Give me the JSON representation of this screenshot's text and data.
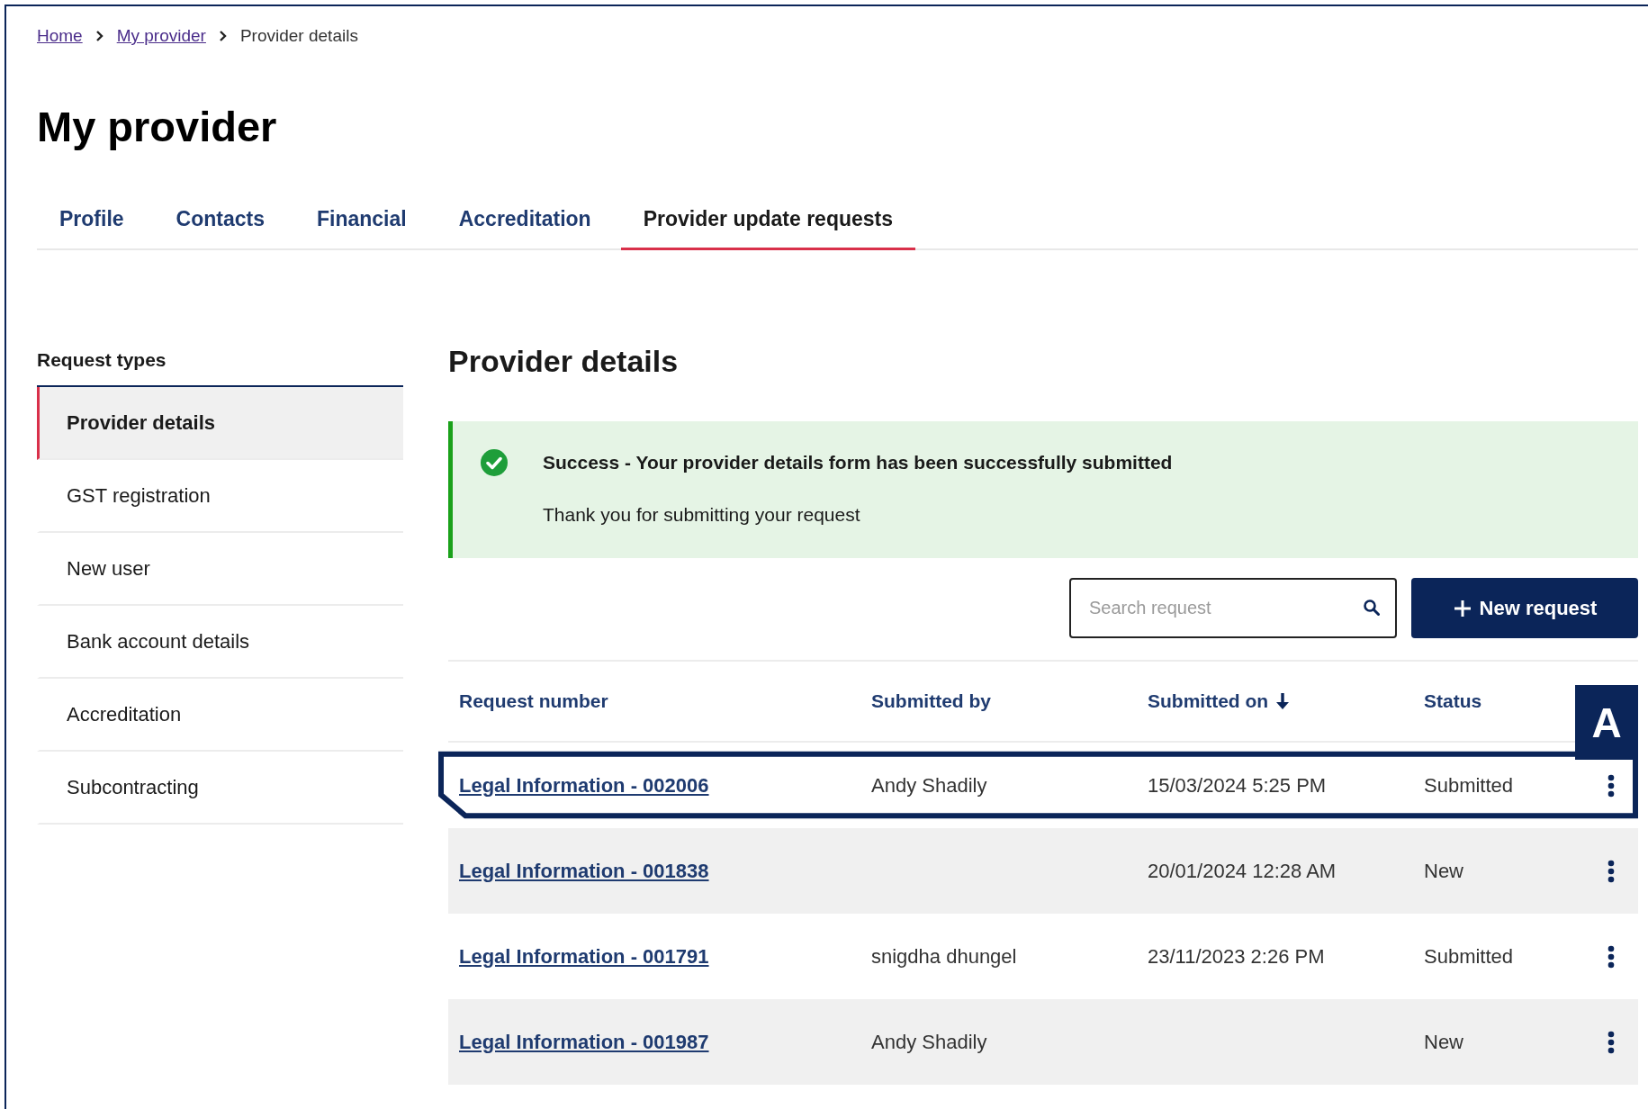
{
  "breadcrumb": [
    {
      "label": "Home",
      "link": true
    },
    {
      "label": "My provider",
      "link": true
    },
    {
      "label": "Provider details",
      "link": false
    }
  ],
  "title": "My provider",
  "tabs": [
    {
      "label": "Profile",
      "selected": false
    },
    {
      "label": "Contacts",
      "selected": false
    },
    {
      "label": "Financial",
      "selected": false
    },
    {
      "label": "Accreditation",
      "selected": false
    },
    {
      "label": "Provider update requests",
      "selected": true
    }
  ],
  "sidebar": {
    "heading": "Request types",
    "items": [
      {
        "label": "Provider details",
        "selected": true
      },
      {
        "label": "GST registration",
        "selected": false
      },
      {
        "label": "New user",
        "selected": false
      },
      {
        "label": "Bank account details",
        "selected": false
      },
      {
        "label": "Accreditation",
        "selected": false
      },
      {
        "label": "Subcontracting",
        "selected": false
      }
    ]
  },
  "section_title": "Provider details",
  "alert": {
    "title": "Success - Your provider details form has been successfully submitted",
    "message": "Thank you for submitting your request"
  },
  "search": {
    "placeholder": "Search request"
  },
  "new_button": "New request",
  "table": {
    "columns": [
      {
        "label": "Request number",
        "sorted": false
      },
      {
        "label": "Submitted by",
        "sorted": false
      },
      {
        "label": "Submitted on",
        "sorted": true
      },
      {
        "label": "Status",
        "sorted": false
      }
    ],
    "rows": [
      {
        "request": "Legal Information - 002006",
        "submitted_by": "Andy Shadily",
        "submitted_on": "15/03/2024 5:25 PM",
        "status": "Submitted",
        "highlighted": true
      },
      {
        "request": "Legal Information - 001838",
        "submitted_by": "",
        "submitted_on": "20/01/2024 12:28 AM",
        "status": "New",
        "highlighted": false
      },
      {
        "request": "Legal Information - 001791",
        "submitted_by": "snigdha dhungel",
        "submitted_on": "23/11/2023 2:26 PM",
        "status": "Submitted",
        "highlighted": false
      },
      {
        "request": "Legal Information - 001987",
        "submitted_by": "Andy Shadily",
        "submitted_on": "",
        "status": "New",
        "highlighted": false
      }
    ]
  },
  "annotation": {
    "label": "A"
  }
}
